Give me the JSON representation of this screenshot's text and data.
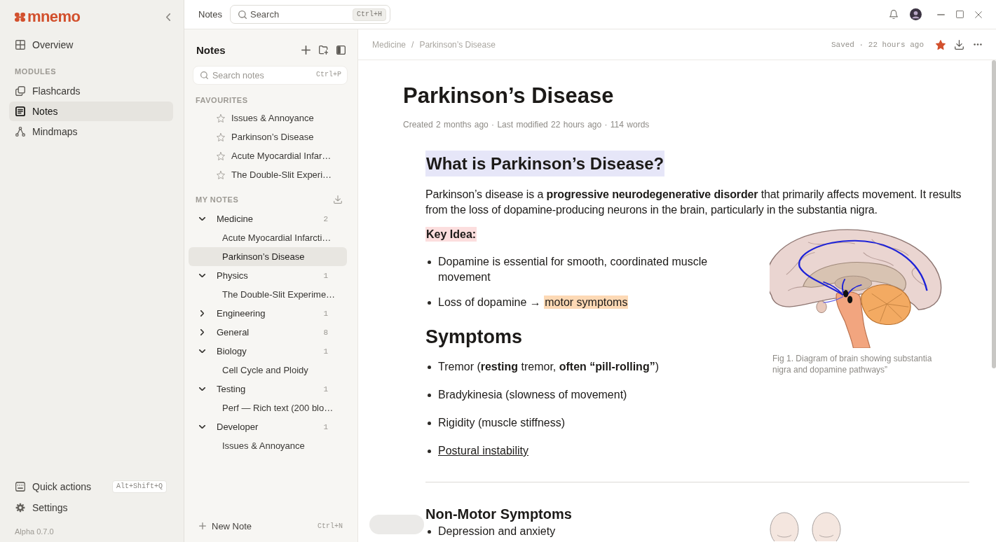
{
  "sidebar": {
    "logo": "mnemo",
    "nav": [
      {
        "label": "Overview",
        "selected": false
      }
    ],
    "modules_label": "MODULES",
    "modules": [
      {
        "label": "Flashcards",
        "selected": false
      },
      {
        "label": "Notes",
        "selected": true
      },
      {
        "label": "Mindmaps",
        "selected": false
      }
    ],
    "footer": [
      {
        "label": "Quick actions",
        "shortcut": "Alt+Shift+Q"
      },
      {
        "label": "Settings"
      }
    ],
    "version": "Alpha 0.7.0"
  },
  "topbar": {
    "title": "Notes",
    "search": {
      "placeholder": "Search",
      "shortcut": "Ctrl+H"
    }
  },
  "notes_panel": {
    "title": "Notes",
    "search": {
      "placeholder": "Search notes",
      "shortcut": "Ctrl+P"
    },
    "favourites": {
      "label": "FAVOURITES",
      "items": [
        {
          "title": "Issues & Annoyance",
          "selected": false
        },
        {
          "title": "Parkinson’s Disease",
          "selected": false
        },
        {
          "title": "Acute Myocardial Infar…",
          "selected": false
        },
        {
          "title": "The Double-Slit Experi…",
          "selected": false
        }
      ]
    },
    "my_notes": {
      "label": "MY NOTES",
      "folders": [
        {
          "name": "Medicine",
          "count": "2",
          "expanded": true,
          "children": [
            {
              "title": "Acute Myocardial Infarcti…",
              "selected": false
            },
            {
              "title": "Parkinson’s Disease",
              "selected": true
            }
          ]
        },
        {
          "name": "Physics",
          "count": "1",
          "expanded": true,
          "children": [
            {
              "title": "The Double-Slit Experime…",
              "selected": false
            }
          ]
        },
        {
          "name": "Engineering",
          "count": "1",
          "expanded": false
        },
        {
          "name": "General",
          "count": "8",
          "expanded": false
        },
        {
          "name": "Biology",
          "count": "1",
          "expanded": true,
          "children": [
            {
              "title": "Cell Cycle and Ploidy",
              "selected": false
            }
          ]
        },
        {
          "name": "Testing",
          "count": "1",
          "expanded": true,
          "children": [
            {
              "title": "Perf — Rich text (200 blo…",
              "selected": false
            }
          ]
        },
        {
          "name": "Developer",
          "count": "1",
          "expanded": true,
          "children": [
            {
              "title": "Issues & Annoyance",
              "selected": false
            }
          ]
        }
      ]
    },
    "new_note": {
      "label": "New Note",
      "shortcut": "Ctrl+N"
    }
  },
  "editor": {
    "breadcrumb": {
      "folder": "Medicine",
      "separator": "/",
      "note": "Parkinson’s Disease"
    },
    "status": "Saved · 22 hours ago",
    "starred": true,
    "title": "Parkinson’s Disease",
    "meta": "Created 2 months ago · Last modified 22 hours ago · 114 words",
    "blocks": [
      {
        "kind": "heading2",
        "text": "What is Parkinson’s Disease?",
        "color": "#e6e6f8"
      },
      {
        "kind": "paragraph",
        "text": "Parkinson’s disease is a **progressive neurodegenerative disorder** that primarily affects movement. It results from the loss of dopamine-producing neurons in the brain, particularly in the substantia nigra."
      },
      {
        "kind": "columns",
        "main": [
          {
            "kind": "label",
            "text": "Key Idea:",
            "color": "#fcdede"
          },
          {
            "kind": "bullets",
            "items": [
              {
                "segments": [
                  {
                    "text": "Dopamine is essential for smooth, coordinated muscle movement"
                  }
                ]
              },
              {
                "segments": [
                  {
                    "text": "Loss of dopamine → "
                  },
                  {
                    "text": "motor symptoms",
                    "color": "#fdd9b5"
                  }
                ]
              }
            ]
          },
          {
            "kind": "heading1",
            "text": "Symptoms"
          },
          {
            "kind": "bullets",
            "items": [
              {
                "segments": [
                  {
                    "text": "Tremor (**resting** tremor, **often** **“pill-rolling”**)"
                  }
                ],
                "link": false
              },
              {
                "segments": [
                  {
                    "text": "Bradykinesia (slowness of movement)"
                  }
                ],
                "link": false
              },
              {
                "segments": [
                  {
                    "text": "Rigidity (muscle stiffness)"
                  }
                ],
                "link": false
              },
              {
                "segments": [
                  {
                    "text": "Postural instability"
                  }
                ],
                "link": true
              }
            ]
          }
        ],
        "figure": {
          "kind": "brain",
          "caption": "Fig 1. Diagram of brain showing substantia nigra and dopamine pathways”"
        }
      },
      {
        "kind": "rule"
      },
      {
        "kind": "columns",
        "main": [
          {
            "kind": "heading3",
            "text": "Non-Motor Symptoms"
          },
          {
            "kind": "bullets",
            "items": [
              {
                "segments": [
                  {
                    "text": "Depression and anxiety"
                  }
                ]
              }
            ]
          }
        ],
        "figure": {
          "kind": "heads"
        }
      }
    ]
  }
}
